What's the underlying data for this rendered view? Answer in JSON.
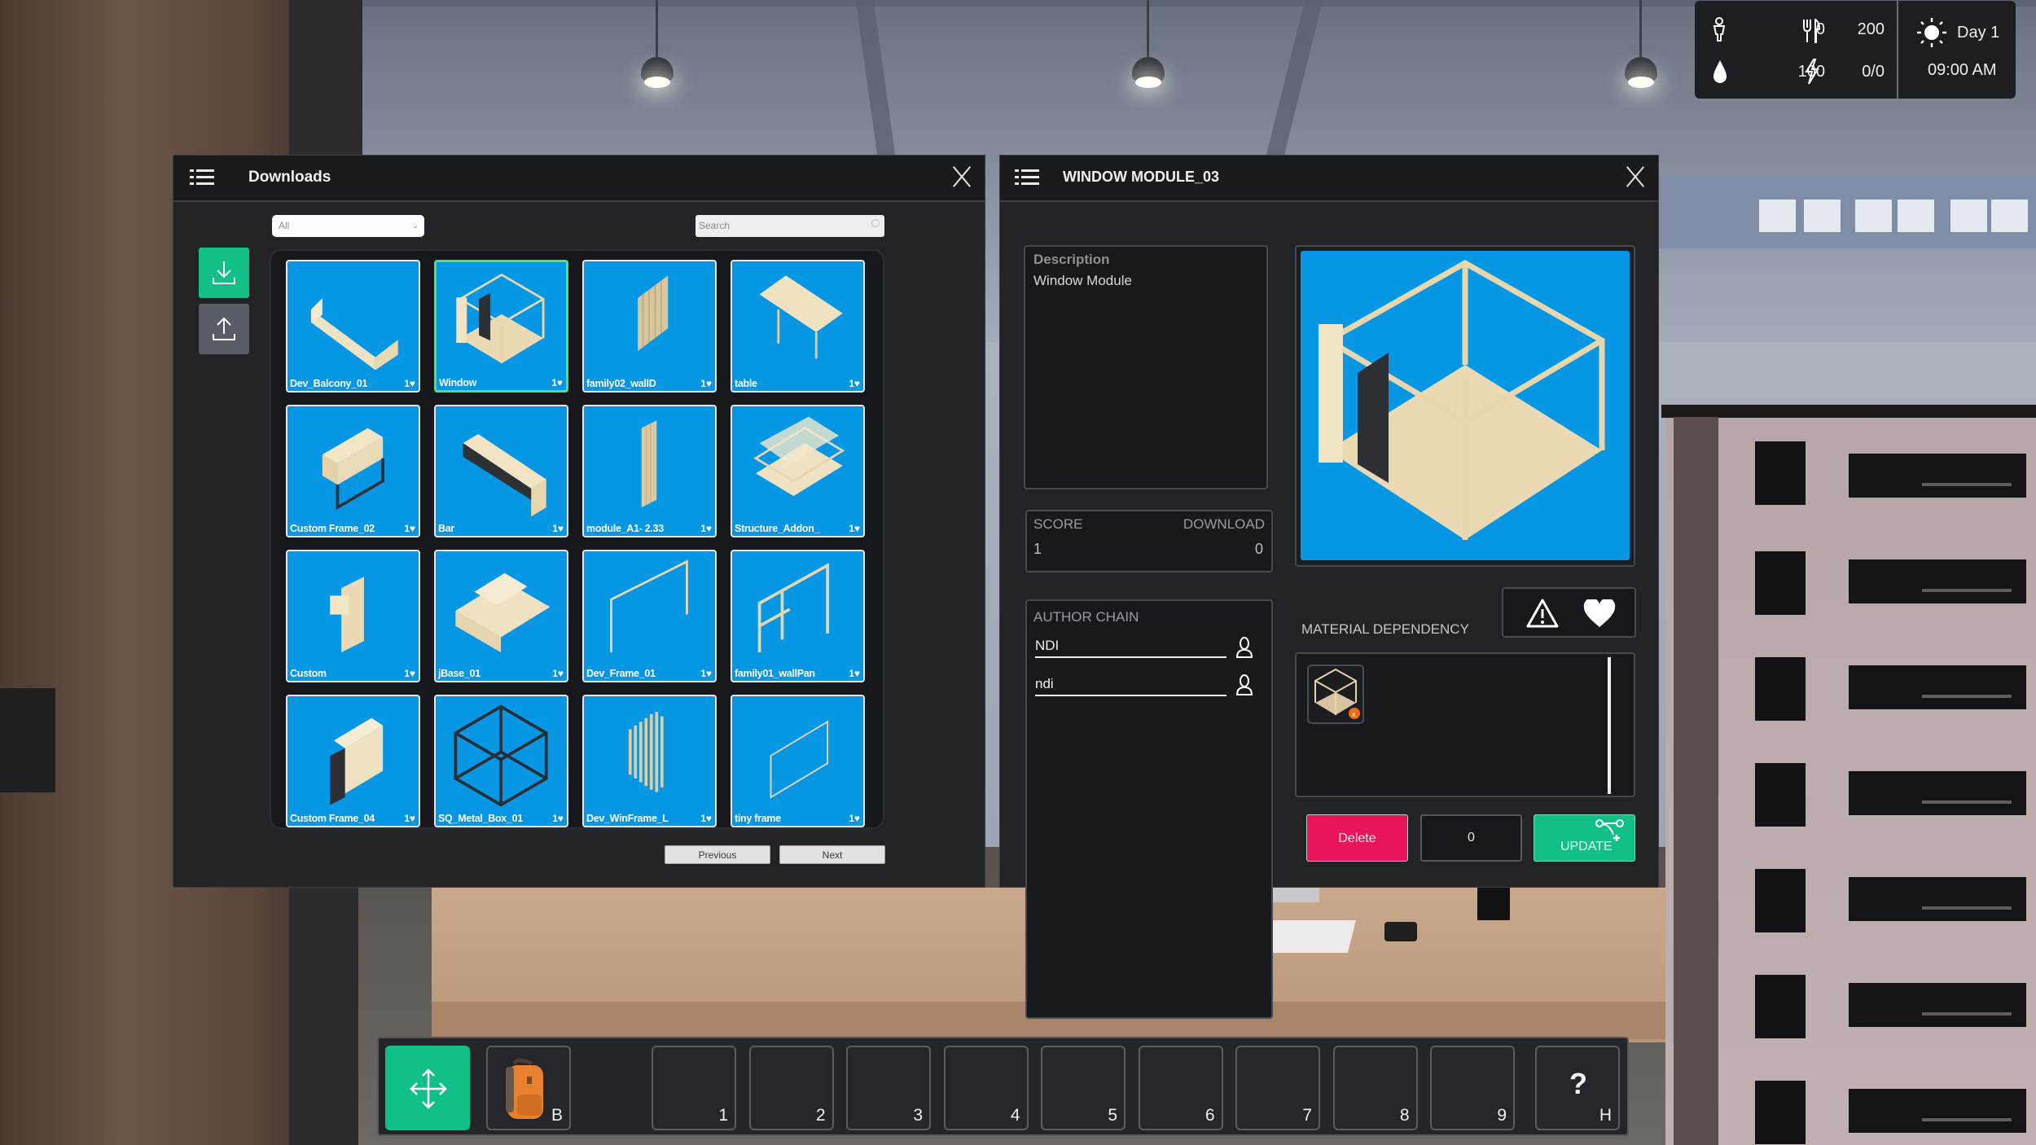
{
  "hud": {
    "population": "0",
    "food": "200",
    "water": "100",
    "power": "0/0",
    "day": "Day 1",
    "time": "09:00 AM",
    "icons": [
      "person-icon",
      "fork-knife-icon",
      "water-drop-icon",
      "lightning-icon",
      "sun-icon"
    ]
  },
  "downloads": {
    "title": "Downloads",
    "filter": {
      "selected": "All"
    },
    "search": {
      "placeholder": "Search",
      "value": ""
    },
    "side_buttons": [
      {
        "name": "download",
        "icon": "download-icon",
        "active": true
      },
      {
        "name": "upload",
        "icon": "upload-icon",
        "active": false
      }
    ],
    "items": [
      {
        "name": "Dev_Balcony_01",
        "likes": "1",
        "selected": false
      },
      {
        "name": "Window",
        "likes": "1",
        "selected": true
      },
      {
        "name": "family02_wallD",
        "likes": "1",
        "selected": false
      },
      {
        "name": "table",
        "likes": "1",
        "selected": false
      },
      {
        "name": "Custom Frame_02",
        "likes": "1",
        "selected": false
      },
      {
        "name": "Bar",
        "likes": "1",
        "selected": false
      },
      {
        "name": "module_A1- 2.33",
        "likes": "1",
        "selected": false
      },
      {
        "name": "Structure_Addon_",
        "likes": "1",
        "selected": false
      },
      {
        "name": "Custom",
        "likes": "1",
        "selected": false
      },
      {
        "name": "jBase_01",
        "likes": "1",
        "selected": false
      },
      {
        "name": "Dev_Frame_01",
        "likes": "1",
        "selected": false
      },
      {
        "name": "family01_wallPan",
        "likes": "1",
        "selected": false
      },
      {
        "name": "Custom Frame_04",
        "likes": "1",
        "selected": false
      },
      {
        "name": "SQ_Metal_Box_01",
        "likes": "1",
        "selected": false
      },
      {
        "name": "Dev_WinFrame_L",
        "likes": "1",
        "selected": false
      },
      {
        "name": "tiny frame",
        "likes": "1",
        "selected": false
      }
    ],
    "previous_label": "Previous",
    "next_label": "Next"
  },
  "detail": {
    "title": "WINDOW MODULE_03",
    "description_label": "Description",
    "description": "Window Module",
    "score_label": "SCORE",
    "score": "1",
    "download_label": "DOWNLOAD",
    "download": "0",
    "author_chain_label": "AUTHOR CHAIN",
    "authors": [
      "NDI",
      "ndi"
    ],
    "material_dependency_label": "MATERIAL DEPENDENCY",
    "delete_label": "Delete",
    "quantity": "0",
    "update_label": "UPDATE"
  },
  "hotbar": {
    "move_tool": "move-arrows-icon",
    "backpack_key": "B",
    "slots": [
      "1",
      "2",
      "3",
      "4",
      "5",
      "6",
      "7",
      "8",
      "9"
    ],
    "help_symbol": "?",
    "help_key": "H"
  },
  "colors": {
    "accent_green": "#10c088",
    "delete_pink": "#ea1558",
    "tile_blue": "#0596e4",
    "selected_outline": "#4fe27a",
    "panel_bg": "#222327"
  }
}
